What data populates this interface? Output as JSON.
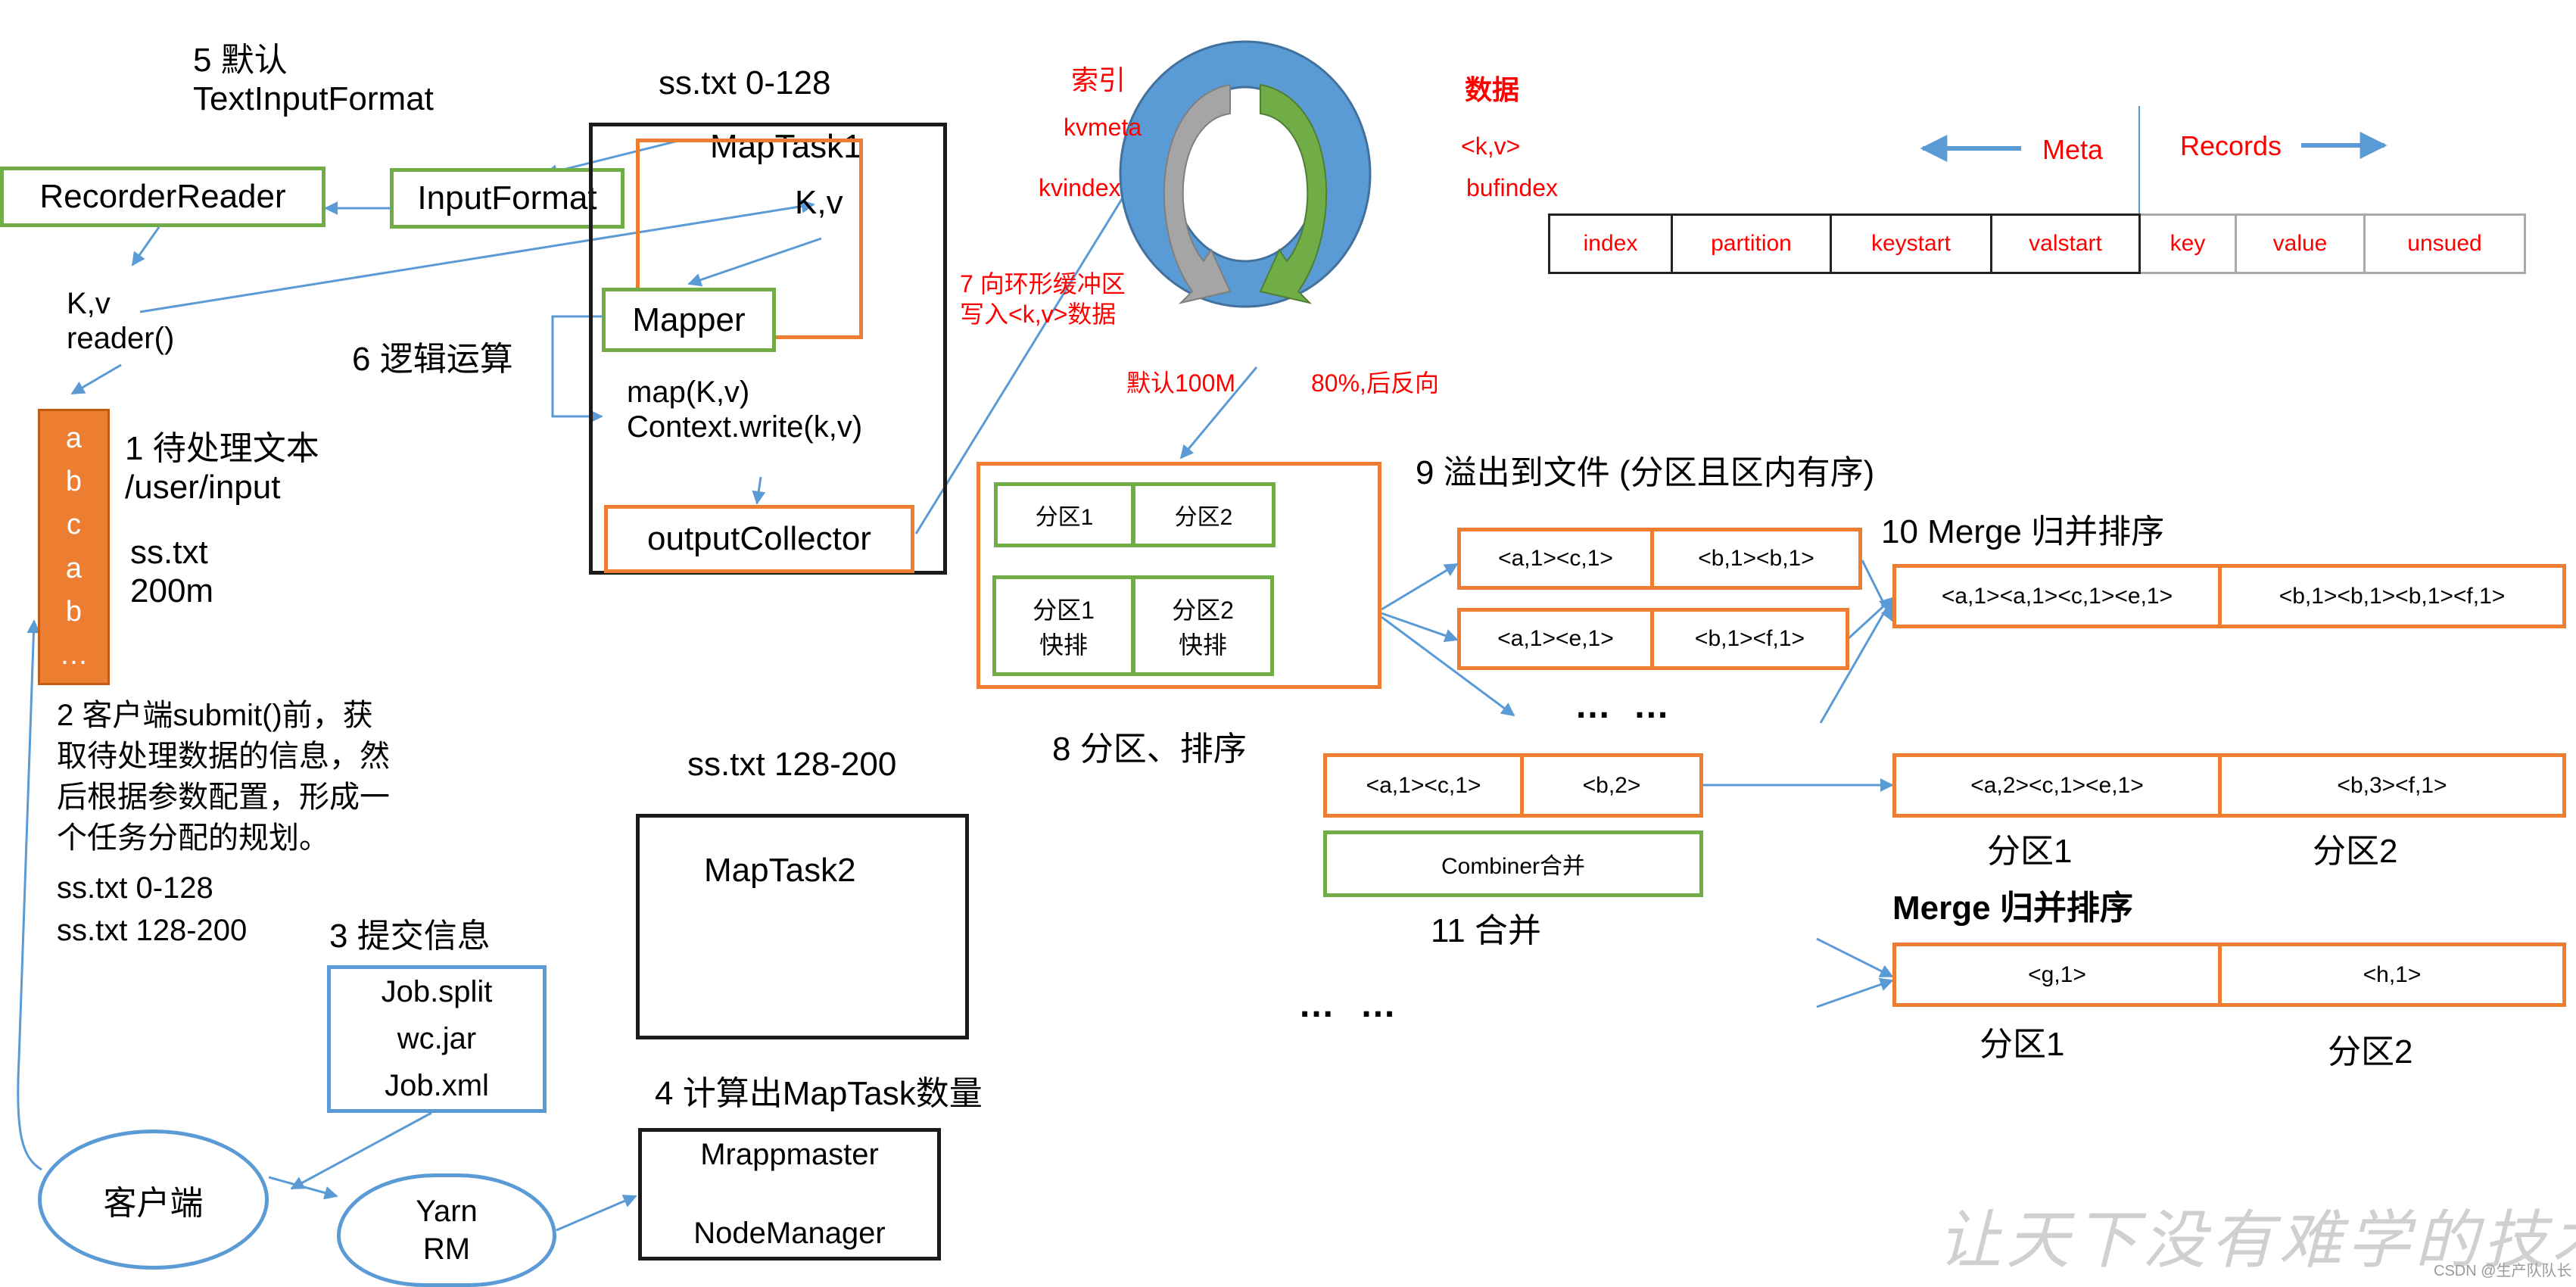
{
  "step5": {
    "line1": "5 默认",
    "line2": "TextInputFormat"
  },
  "recorder_reader": "RecorderReader",
  "input_format": "InputFormat",
  "kv_reader": {
    "line1": "K,v",
    "line2": "reader()"
  },
  "step6": "6 逻辑运算",
  "maptask1": {
    "split_label": "ss.txt 0-128",
    "title": "MapTask1",
    "kv": "K,v",
    "mapper": "Mapper",
    "map_call": "map(K,v)",
    "context_write": "Context.write(k,v)",
    "output_collector": "outputCollector"
  },
  "input_file": {
    "chars": [
      "a",
      "b",
      "c",
      "a",
      "b",
      "…"
    ],
    "step1": "1 待处理文本",
    "path": "/user/input",
    "file": "ss.txt",
    "size": "200m"
  },
  "step2": {
    "lines": [
      "2 客户端submit()前，获",
      "取待处理数据的信息，然",
      "后根据参数配置，形成一",
      "个任务分配的规划。"
    ],
    "split1": "ss.txt  0-128",
    "split2": "ss.txt  128-200"
  },
  "step3": {
    "title": "3 提交信息",
    "files": [
      "Job.split",
      "wc.jar",
      "Job.xml"
    ]
  },
  "client": "客户端",
  "yarn": {
    "line1": "Yarn",
    "line2": "RM"
  },
  "step4": {
    "title": "4 计算出MapTask数量",
    "line1": "Mrappmaster",
    "line2": "NodeManager"
  },
  "maptask2": {
    "split_label": "ss.txt 128-200",
    "title": "MapTask2"
  },
  "ring_buffer": {
    "index_label": "索引",
    "kvmeta": "kvmeta",
    "kvindex": "kvindex",
    "data_label": "数据",
    "kv": "<k,v>",
    "bufindex": "bufindex",
    "step7": {
      "line1": "7 向环形缓冲区",
      "line2": "写入<k,v>数据"
    },
    "default_size": "默认100M",
    "threshold": "80%,后反向",
    "colors": {
      "ring": "#5b9bd5",
      "meta_arrow": "#a5a5a5",
      "data_arrow": "#70ad47"
    }
  },
  "buffer_layout": {
    "meta_label": "Meta",
    "records_label": "Records",
    "meta_cells": [
      "index",
      "partition",
      "keystart",
      "valstart"
    ],
    "record_cells": [
      "key",
      "value",
      "unsued"
    ]
  },
  "partition_sort": {
    "partitions": [
      "分区1",
      "分区2"
    ],
    "quick_sort": [
      {
        "line1": "分区1",
        "line2": "快排"
      },
      {
        "line1": "分区2",
        "line2": "快排"
      }
    ],
    "step8": "8 分区、排序"
  },
  "spill": {
    "step9": "9 溢出到文件 (分区且区内有序)",
    "files": [
      {
        "p1": "<a,1><c,1>",
        "p2": "<b,1><b,1>"
      },
      {
        "p1": "<a,1><e,1>",
        "p2": "<b,1><f,1>"
      }
    ],
    "ellipsis": "… …"
  },
  "merge": {
    "step10": "10 Merge 归并排序",
    "p1": "<a,1><a,1><c,1><e,1>",
    "p2": "<b,1><b,1><b,1><f,1>"
  },
  "combiner": {
    "p1": "<a,1><c,1>",
    "p2": "<b,2>",
    "label": "Combiner合并",
    "step11": "11 合并",
    "ellipsis": "… …"
  },
  "combined_output": {
    "p1": "<a,2><c,1><e,1>",
    "p2": "<b,3><f,1>",
    "label1": "分区1",
    "label2": "分区2"
  },
  "merge2": {
    "title": "Merge 归并排序",
    "p1": "<g,1>",
    "p2": "<h,1>",
    "label1": "分区1",
    "label2": "分区2"
  },
  "watermark": "让天下没有难学的技术",
  "credit": "CSDN @生产队队长"
}
